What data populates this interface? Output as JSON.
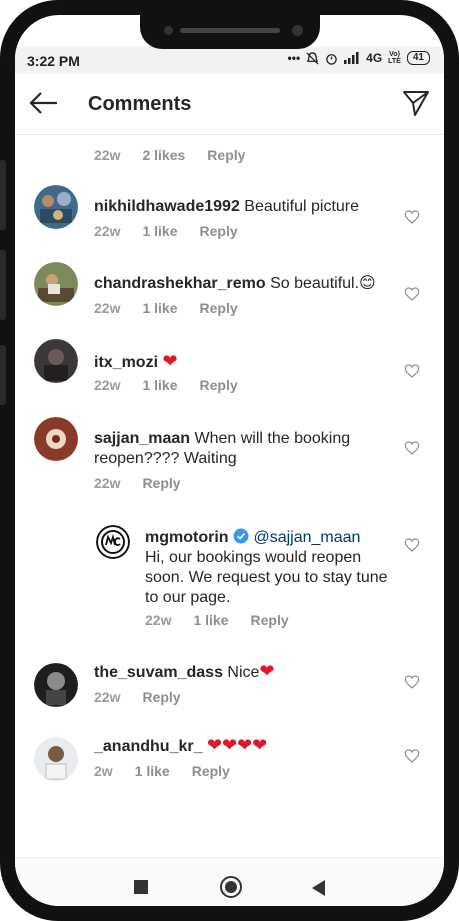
{
  "status": {
    "time": "3:22 PM",
    "network": "4G",
    "lte_top": "Vo)",
    "lte_bottom": "LTE",
    "battery": "41"
  },
  "header": {
    "title": "Comments",
    "back_icon": "arrow-left-icon",
    "send_icon": "paper-plane-icon"
  },
  "top_partial": {
    "time": "22w",
    "likes": "2 likes",
    "reply": "Reply"
  },
  "comments": [
    {
      "user": "nikhildhawade1992",
      "text": " Beautiful picture",
      "time": "22w",
      "likes": "1 like",
      "reply": "Reply"
    },
    {
      "user": "chandrashekhar_remo",
      "text": " So beautiful.",
      "emoji": "😊",
      "time": "22w",
      "likes": "1 like",
      "reply": "Reply"
    },
    {
      "user": "itx_mozi",
      "text": " ",
      "emoji": "❤",
      "time": "22w",
      "likes": "1 like",
      "reply": "Reply"
    },
    {
      "user": "sajjan_maan",
      "text": " When will the booking reopen???? Waiting",
      "time": "22w",
      "reply": "Reply"
    },
    {
      "user": "mgmotorin",
      "mention": "@sajjan_maan",
      "text": "Hi, our bookings would reopen soon. We request you to stay tune to our page.",
      "time": "22w",
      "likes": "1 like",
      "reply": "Reply"
    },
    {
      "user": "the_suvam_dass",
      "text": " Nice",
      "emoji": "❤",
      "time": "22w",
      "reply": "Reply"
    },
    {
      "user": "_anandhu_kr_",
      "text": " ",
      "emoji": "❤❤❤❤",
      "time": "2w",
      "likes": "1 like",
      "reply": "Reply"
    }
  ],
  "colors": {
    "accent_red": "#e0162b",
    "verified_blue": "#3897f0",
    "meta_gray": "#8e8e8e"
  }
}
